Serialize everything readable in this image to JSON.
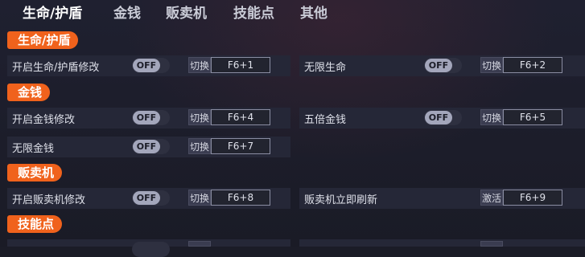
{
  "tabs": [
    {
      "label": "生命/护盾",
      "active": true
    },
    {
      "label": "金钱",
      "active": false
    },
    {
      "label": "贩卖机",
      "active": false
    },
    {
      "label": "技能点",
      "active": false
    },
    {
      "label": "其他",
      "active": false
    }
  ],
  "sections": {
    "health": "生命/护盾",
    "money": "金钱",
    "vending": "贩卖机",
    "skills": "技能点"
  },
  "options": {
    "health_mod": {
      "label": "开启生命/护盾修改",
      "toggle": "OFF",
      "btn": "切换",
      "hotkey": "F6+1"
    },
    "infinite_health": {
      "label": "无限生命",
      "toggle": "OFF",
      "btn": "切换",
      "hotkey": "F6+2"
    },
    "money_mod": {
      "label": "开启金钱修改",
      "toggle": "OFF",
      "btn": "切换",
      "hotkey": "F6+4"
    },
    "five_x_money": {
      "label": "五倍金钱",
      "toggle": "OFF",
      "btn": "切换",
      "hotkey": "F6+5"
    },
    "infinite_money": {
      "label": "无限金钱",
      "toggle": "OFF",
      "btn": "切换",
      "hotkey": "F6+7"
    },
    "vending_mod": {
      "label": "开启贩卖机修改",
      "toggle": "OFF",
      "btn": "切换",
      "hotkey": "F6+8"
    },
    "vending_refresh": {
      "label": "贩卖机立即刷新",
      "btn": "激活",
      "hotkey": "F6+9"
    }
  },
  "colors": {
    "accent": "#f0621c",
    "row_bg": "#252737",
    "bg": "#1b1c27"
  }
}
